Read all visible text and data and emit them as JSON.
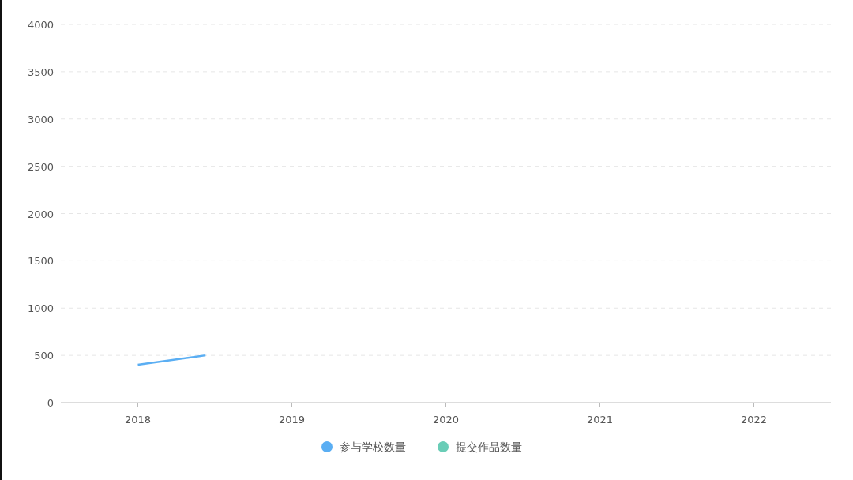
{
  "chart_data": {
    "type": "line",
    "grid": true,
    "x": [
      2018,
      2018.44
    ],
    "xlim": [
      2017.5,
      2022.5
    ],
    "ylim": [
      0,
      4000
    ],
    "xticks": [
      2018,
      2019,
      2020,
      2021,
      2022
    ],
    "yticks": [
      0,
      500,
      1000,
      1500,
      2000,
      2500,
      3000,
      3500,
      4000
    ],
    "series": [
      {
        "name": "参与学校数量",
        "color": "#5aaef3",
        "values": [
          400,
          500
        ]
      },
      {
        "name": "提交作品数量",
        "color": "#6acdb7",
        "values": [
          null,
          null
        ]
      }
    ]
  }
}
